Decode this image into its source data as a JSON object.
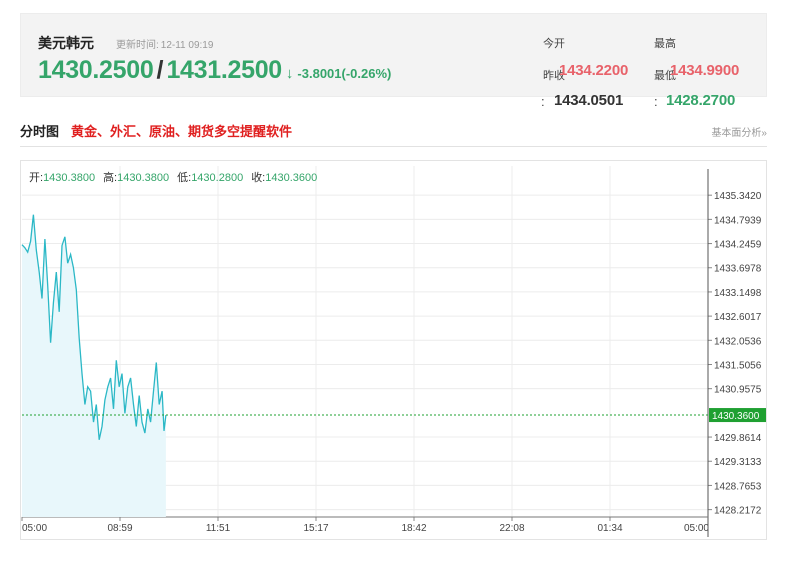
{
  "quote": {
    "name": "美元韩元",
    "update_label": "更新时间:",
    "update_time": "12-11 09:19",
    "bid": "1430.2500",
    "ask": "1431.2500",
    "arrow": "↓",
    "change": "-3.8001(-0.26%)",
    "open_label": "今开",
    "open_value": "1434.2200",
    "high_label": "最高",
    "high_value": "1434.9900",
    "prev_close_label": "昨收",
    "prev_close_value": "1434.0501",
    "low_label": "最低",
    "low_value": "1428.2700"
  },
  "section": {
    "title": "分时图",
    "promo": "黄金、外汇、原油、期货多空提醒软件",
    "link": "基本面分析»"
  },
  "legend": {
    "open_label": "开:",
    "open_value": "1430.3800",
    "high_label": "高:",
    "high_value": "1430.3800",
    "low_label": "低:",
    "low_value": "1430.2800",
    "close_label": "收:",
    "close_value": "1430.3600"
  },
  "colors": {
    "line": "#2bb8c6",
    "fill": "#e8f7fb",
    "green": "#35a56a",
    "red": "#e8626a",
    "grid": "#ececec",
    "current_bg": "#1fa031"
  },
  "chart_data": {
    "type": "area",
    "x_ticks": [
      "05:00",
      "08:59",
      "11:51",
      "15:17",
      "18:42",
      "22:08",
      "01:34",
      "05:00"
    ],
    "y_ticks": [
      "1435.3420",
      "1434.7939",
      "1434.2459",
      "1433.6978",
      "1433.1498",
      "1432.6017",
      "1432.0536",
      "1431.5056",
      "1430.9575",
      "1430.3600",
      "1429.8614",
      "1429.3133",
      "1428.7653",
      "1428.2172"
    ],
    "y_tick_values": [
      1435.342,
      1434.7939,
      1434.2459,
      1433.6978,
      1433.1498,
      1432.6017,
      1432.0536,
      1431.5056,
      1430.9575,
      1430.36,
      1429.8614,
      1429.3133,
      1428.7653,
      1428.2172
    ],
    "ylim": [
      1428.05,
      1435.55
    ],
    "current_value": 1430.36,
    "current_label": "1430.3600",
    "x_slots": 1440,
    "grid": true,
    "series": [
      {
        "values": [
          [
            0,
            1434.22
          ],
          [
            6,
            1434.15
          ],
          [
            12,
            1434.05
          ],
          [
            18,
            1434.3
          ],
          [
            24,
            1434.9
          ],
          [
            30,
            1434.1
          ],
          [
            36,
            1433.6
          ],
          [
            42,
            1433.0
          ],
          [
            48,
            1434.35
          ],
          [
            54,
            1433.3
          ],
          [
            60,
            1432.0
          ],
          [
            66,
            1432.9
          ],
          [
            72,
            1433.6
          ],
          [
            78,
            1432.7
          ],
          [
            84,
            1434.2
          ],
          [
            90,
            1434.4
          ],
          [
            96,
            1433.8
          ],
          [
            102,
            1434.0
          ],
          [
            108,
            1433.7
          ],
          [
            114,
            1433.2
          ],
          [
            120,
            1432.1
          ],
          [
            126,
            1431.3
          ],
          [
            132,
            1430.6
          ],
          [
            138,
            1431.0
          ],
          [
            144,
            1430.9
          ],
          [
            150,
            1430.2
          ],
          [
            156,
            1430.6
          ],
          [
            162,
            1429.8
          ],
          [
            168,
            1430.1
          ],
          [
            174,
            1430.7
          ],
          [
            180,
            1431.0
          ],
          [
            186,
            1431.2
          ],
          [
            192,
            1430.5
          ],
          [
            198,
            1431.6
          ],
          [
            204,
            1431.0
          ],
          [
            210,
            1431.3
          ],
          [
            216,
            1430.4
          ],
          [
            222,
            1431.0
          ],
          [
            228,
            1431.2
          ],
          [
            234,
            1430.6
          ],
          [
            240,
            1430.1
          ],
          [
            246,
            1430.8
          ],
          [
            252,
            1430.2
          ],
          [
            258,
            1429.95
          ],
          [
            264,
            1430.5
          ],
          [
            270,
            1430.2
          ],
          [
            276,
            1430.9
          ],
          [
            282,
            1431.55
          ],
          [
            288,
            1430.6
          ],
          [
            294,
            1430.9
          ],
          [
            298,
            1430.0
          ],
          [
            302,
            1430.36
          ]
        ]
      }
    ]
  }
}
